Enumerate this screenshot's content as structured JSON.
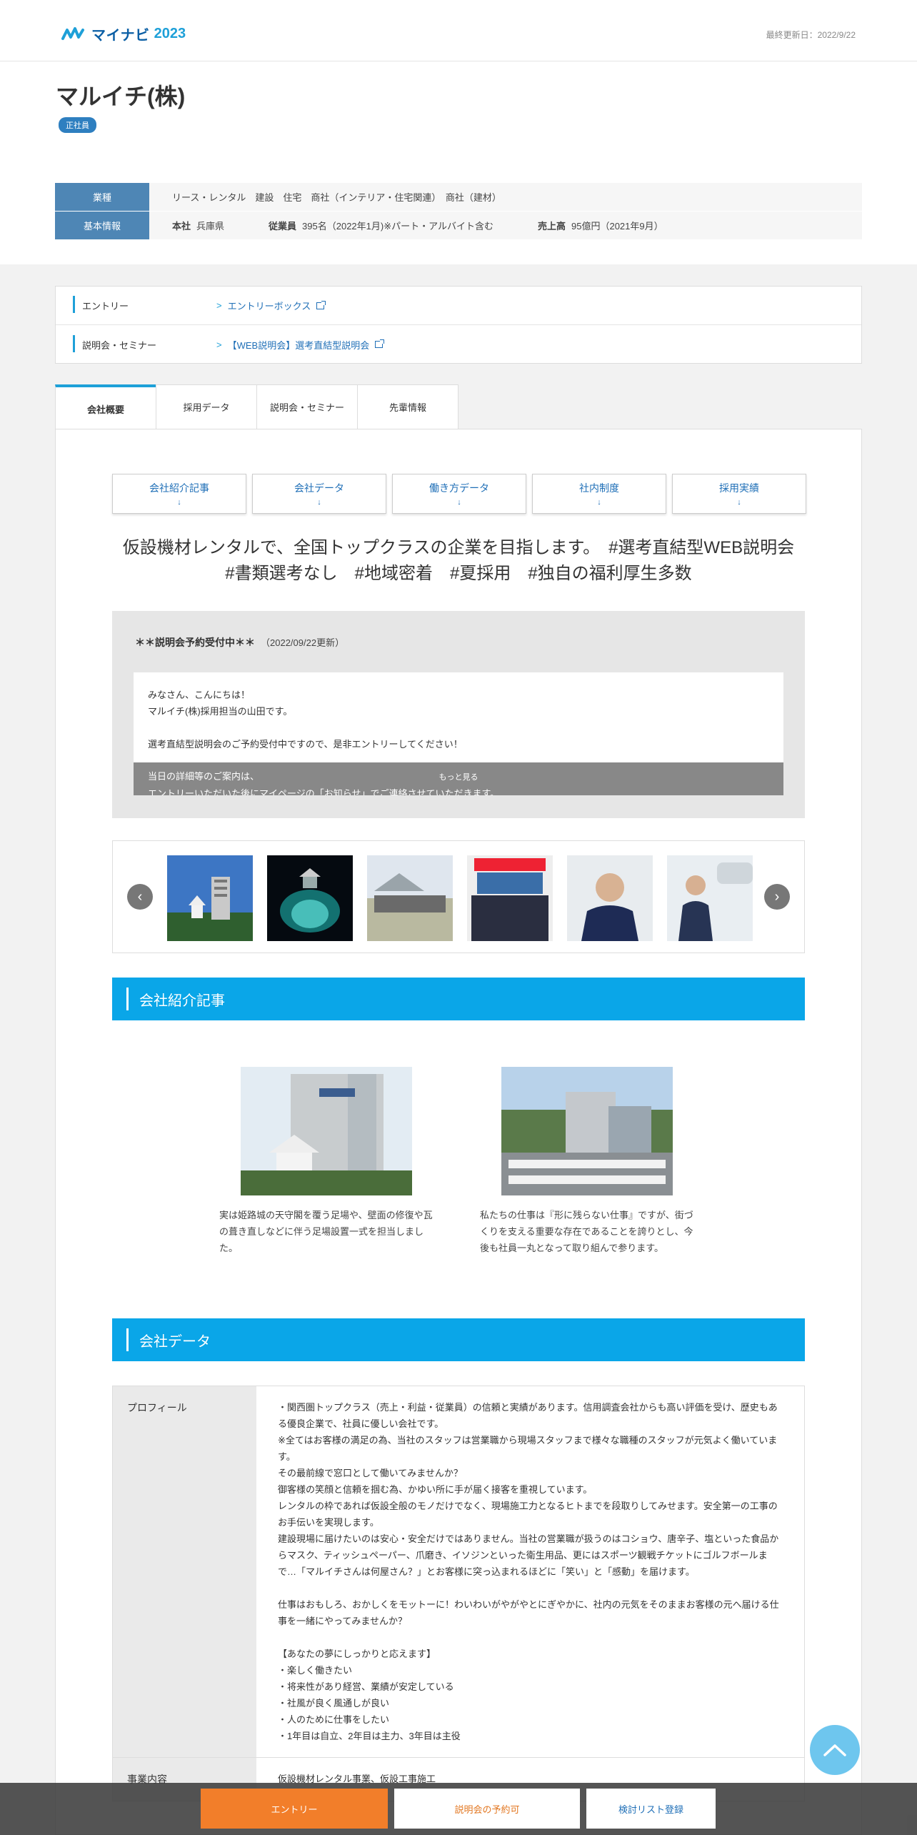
{
  "header": {
    "logo_text": "マイナビ",
    "logo_year": "2023",
    "updated": "最終更新日：2022/9/22"
  },
  "company": {
    "name": "マルイチ(株)",
    "badge": "正社員"
  },
  "info": {
    "industry_label": "業種",
    "industry_value": "リース・レンタル　建設　住宅　商社（インテリア・住宅関連）　商社（建材）",
    "basic_label": "基本情報",
    "hq_label": "本社",
    "hq_value": "兵庫県",
    "employees_label": "従業員",
    "employees_value": "395名（2022年1月)※パート・アルバイト含む",
    "sales_label": "売上高",
    "sales_value": "95億円（2021年9月）"
  },
  "links": {
    "entry_label": "エントリー",
    "entry_target": "エントリーボックス",
    "seminar_label": "説明会・セミナー",
    "seminar_target": "【WEB説明会】選考直結型説明会"
  },
  "tabs": [
    "会社概要",
    "採用データ",
    "説明会・セミナー",
    "先輩情報"
  ],
  "anchors": [
    "会社紹介記事",
    "会社データ",
    "働き方データ",
    "社内制度",
    "採用実績"
  ],
  "anchor_arrow": "↓",
  "catch_copy": "仮設機材レンタルで、全国トップクラスの企業を目指します。　#選考直結型WEB説明会　#書類選考なし　#地域密着　#夏採用　#独自の福利厚生多数",
  "notice": {
    "title": "＊＊説明会予約受付中＊＊",
    "date": "（2022/09/22更新）",
    "body": "みなさん、こんにちは！\nマルイチ(株)採用担当の山田です。\n\n選考直結型説明会のご予約受付中ですので、是非エントリーしてください！",
    "peek": "当日の詳細等のご案内は、\nエントリーいただいた後にマイページの「お知らせ」でご連絡させていただきます。",
    "more": "もっと見る"
  },
  "sections": {
    "intro": "会社紹介記事",
    "data": "会社データ"
  },
  "articles": [
    {
      "text": "実は姫路城の天守閣を覆う足場や、壁面の修復や瓦の葺き直しなどに伴う足場設置一式を担当しました。"
    },
    {
      "text": "私たちの仕事は『形に残らない仕事』ですが、街づくりを支える重要な存在であることを誇りとし、今後も社員一丸となって取り組んで参ります。"
    }
  ],
  "data_table": {
    "profile_label": "プロフィール",
    "profile_text": "・関西圏トップクラス（売上・利益・従業員）の信頼と実績があります。信用調査会社からも高い評価を受け、歴史もある優良企業で、社員に優しい会社です。\n※全てはお客様の満足の為、当社のスタッフは営業職から現場スタッフまで様々な職種のスタッフが元気よく働いています。\nその最前線で窓口として働いてみませんか？\n御客様の笑顔と信頼を掴む為、かゆい所に手が届く接客を重視しています。\nレンタルの枠であれば仮設全般のモノだけでなく、現場施工力となるヒトまでを段取りしてみせます。安全第一の工事のお手伝いを実現します。\n建設現場に届けたいのは安心・安全だけではありません。当社の営業職が扱うのはコショウ、唐辛子、塩といった食品からマスク、ティッシュペーパー、爪磨き、イソジンといった衛生用品、更にはスポーツ観戦チケットにゴルフボールまで…「マルイチさんは何屋さん？」とお客様に突っ込まれるほどに「笑い」と「感動」を届けます。\n\n仕事はおもしろ、おかしくをモットーに！わいわいがやがやとにぎやかに、社内の元気をそのままお客様の元へ届ける仕事を一緒にやってみませんか？\n\n【あなたの夢にしっかりと応えます】\n・楽しく働きたい\n・将来性があり経営、業績が安定している\n・社風が良く風通しが良い\n・人のために仕事をしたい\n・1年目は自立、2年目は主力、3年目は主役",
    "business_label": "事業内容",
    "business_text": "仮設機材レンタル事業、仮設工事施工"
  },
  "bottom_bar": {
    "entry": "エントリー",
    "seminar": "説明会の予約可",
    "list": "検討リスト登録"
  },
  "colors": {
    "accent": "#0aa6e8",
    "header_blue": "#4e86b5",
    "entry_orange": "#f27e2a"
  }
}
